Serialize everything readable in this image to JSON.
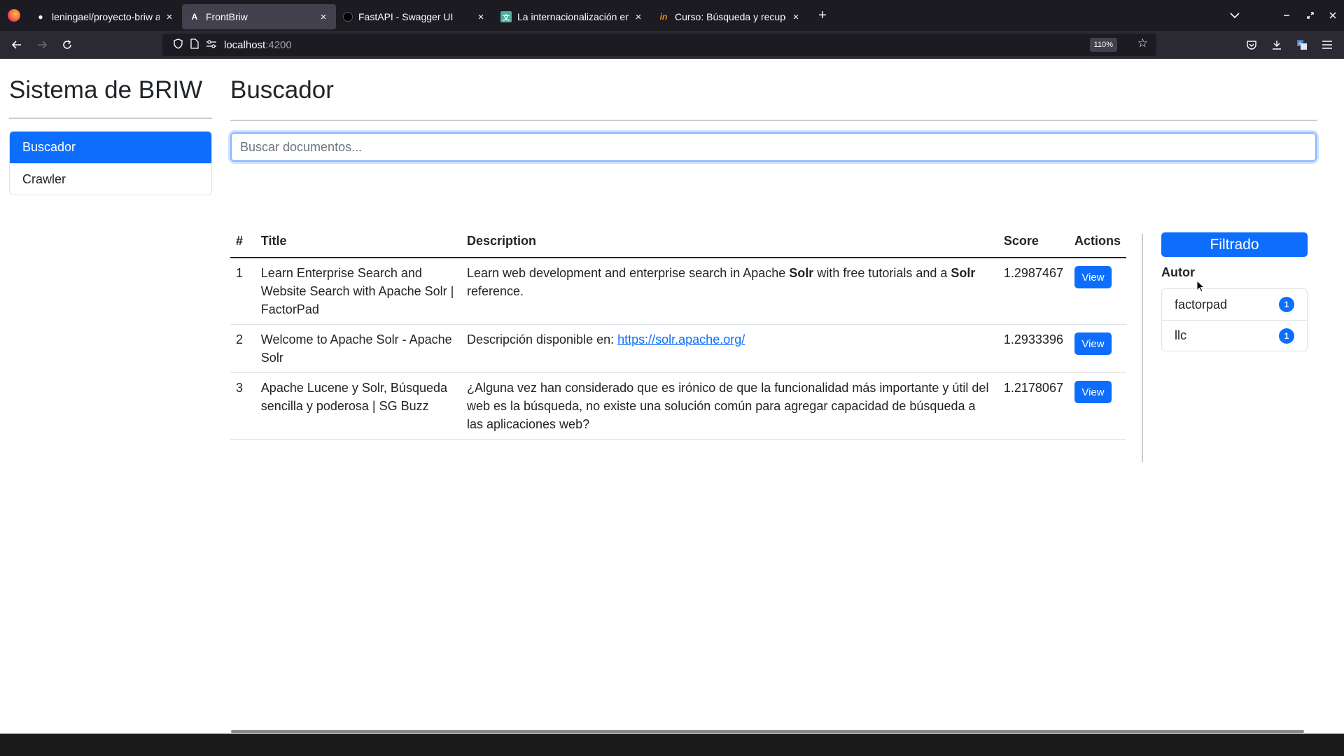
{
  "browser": {
    "tabs": [
      {
        "label": "leningael/proyecto-briw a",
        "icon": "github-icon",
        "active": false
      },
      {
        "label": "FrontBriw",
        "icon": "angular-icon",
        "active": true
      },
      {
        "label": "FastAPI - Swagger UI",
        "icon": "fastapi-icon",
        "active": false
      },
      {
        "label": "La internacionalización en",
        "icon": "translate-icon",
        "active": false
      },
      {
        "label": "Curso: Búsqueda y recupe",
        "icon": "course-icon",
        "active": false
      }
    ],
    "url_host": "localhost",
    "url_port": ":4200",
    "zoom": "110%"
  },
  "sidebar": {
    "brand": "Sistema de BRIW",
    "items": [
      {
        "label": "Buscador",
        "active": true
      },
      {
        "label": "Crawler",
        "active": false
      }
    ]
  },
  "main": {
    "title": "Buscador",
    "search_placeholder": "Buscar documentos..."
  },
  "table": {
    "headers": [
      "#",
      "Title",
      "Description",
      "Score",
      "Actions"
    ],
    "rows": [
      {
        "num": "1",
        "title": "Learn Enterprise Search and Website Search with Apache Solr | FactorPad",
        "desc_parts": [
          {
            "t": "Learn web development and enterprise search in Apache "
          },
          {
            "t": "Solr",
            "bold": true
          },
          {
            "t": " with free tutorials and a "
          },
          {
            "t": "Solr",
            "bold": true
          },
          {
            "t": " reference."
          }
        ],
        "score": "1.2987467",
        "action": "View"
      },
      {
        "num": "2",
        "title": "Welcome to Apache Solr - Apache Solr",
        "desc_parts": [
          {
            "t": "Descripción disponible en: "
          },
          {
            "t": "https://solr.apache.org/",
            "link": true
          }
        ],
        "score": "1.2933396",
        "action": "View"
      },
      {
        "num": "3",
        "title": "Apache Lucene y Solr, Búsqueda sencilla y poderosa | SG Buzz",
        "desc_parts": [
          {
            "t": "¿Alguna vez han considerado que es irónico de que la funcionalidad más importante y útil del web es la búsqueda, no existe una solución común para agregar capacidad de búsqueda a las aplicaciones web?"
          }
        ],
        "score": "1.2178067",
        "action": "View"
      }
    ]
  },
  "filter": {
    "button": "Filtrado",
    "section_label": "Autor",
    "facets": [
      {
        "label": "factorpad",
        "count": "1"
      },
      {
        "label": "llc",
        "count": "1"
      }
    ]
  },
  "colors": {
    "primary": "#0d6efd",
    "browser_dark": "#1c1b22",
    "browser_toolbar": "#2b2a33"
  }
}
